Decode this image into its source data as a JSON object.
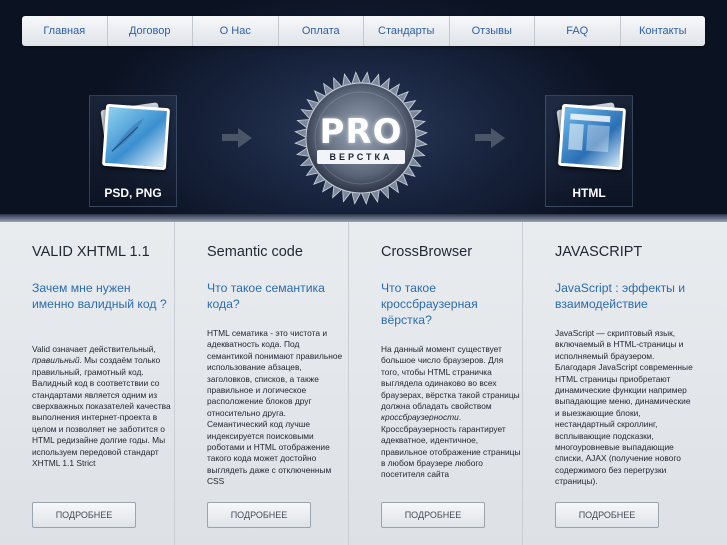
{
  "nav": {
    "items": [
      {
        "label": "Главная"
      },
      {
        "label": "Договор"
      },
      {
        "label": "О Нас"
      },
      {
        "label": "Оплата"
      },
      {
        "label": "Стандарты"
      },
      {
        "label": "Отзывы"
      },
      {
        "label": "FAQ"
      },
      {
        "label": "Контакты"
      }
    ]
  },
  "hero": {
    "left_label": "PSD, PNG",
    "logo_text": "PRO",
    "logo_subtext": "ВЕРСТКА",
    "right_label": "HTML"
  },
  "features": [
    {
      "title": "VALID XHTML 1.1",
      "subtitle": "Зачем мне нужен именно валидный код ?",
      "body_pre": "Valid означает действительный, ",
      "body_em": "правильный",
      "body_post": ". Мы создаём только правильный, грамотный код. Валидный код в соответствии со стандартами является одним из сверхважных показателей качества выполнения интернет-проекта в целом и позволяет не заботится о HTML редизайне долгие годы. Мы используем передовой стандарт XHTML 1.1 Strict",
      "button": "ПОДРОБНЕЕ"
    },
    {
      "title": "Semantic code",
      "subtitle": "Что такое семантика кода?",
      "body_pre": "HTML сематика - это чистота и адекватность кода. Под семантикой понимают правильное использование абзацев, заголовков, списков, а также правильное и логическое расположение блоков друг относительно друга. Семантический код лучше индексируется поисковыми роботами и HTML отображение такого кода может достойно выглядеть даже с отключенным CSS",
      "body_em": "",
      "body_post": "",
      "button": "ПОДРОБНЕЕ"
    },
    {
      "title": "CrossBrowser",
      "subtitle": "Что такое кроссбраузерная вёрстка?",
      "body_pre": "На данный момент существует большое число браузеров. Для того, чтобы HTML страничка выглядела одинаково во всех браузерах, вёрстка такой страницы должна обладать свойством ",
      "body_em": "кроссбраузерности",
      "body_post": ". Кроссбраузерность гарантирует адекватное, идентичное, правильное отображение страницы в любом браузере любого посетителя сайта",
      "button": "ПОДРОБНЕЕ"
    },
    {
      "title": "JAVASCRIPT",
      "subtitle": "JavaScript : эффекты и взаимодействие",
      "body_pre": "JavaScript — скриптовый язык, включаемый в HTML-страницы и исполняемый браузером. Благодаря JavaScript современные HTML страницы приобретают динамические функции например выпадающие меню, динамические и выезжающие блоки, нестандартный скроллинг, всплывающие подсказки, многоуровневые выпадающие списки, AJAX (получение нового содержимого без перегрузки страницы).",
      "body_em": "",
      "body_post": "",
      "button": "ПОДРОБНЕЕ"
    }
  ]
}
